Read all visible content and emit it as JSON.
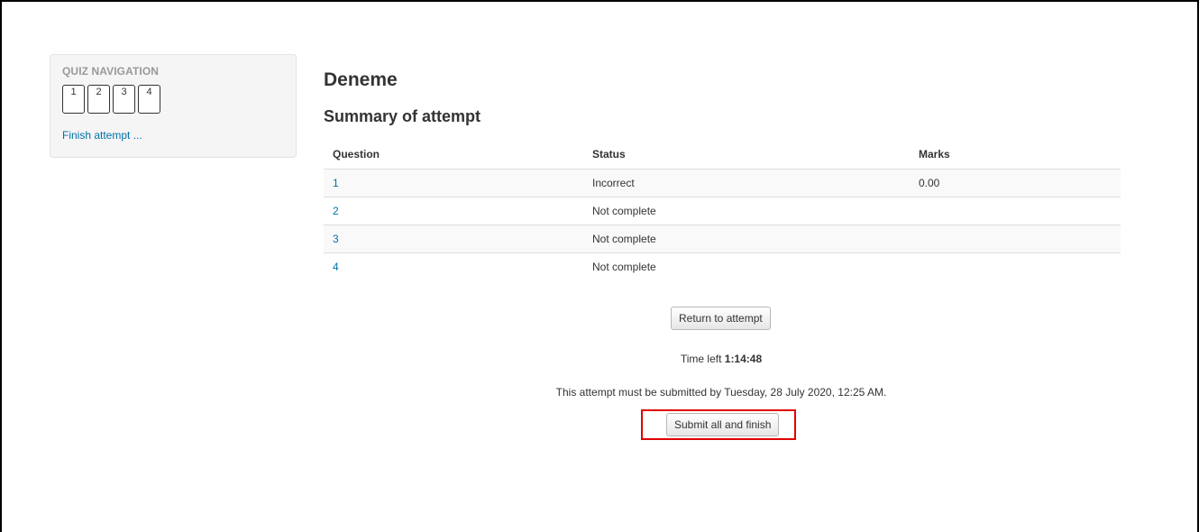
{
  "quiz_navigation": {
    "title": "QUIZ NAVIGATION",
    "buttons": [
      "1",
      "2",
      "3",
      "4"
    ],
    "finish_link": "Finish attempt ..."
  },
  "main": {
    "page_title": "Deneme",
    "summary_heading": "Summary of attempt",
    "table": {
      "headers": [
        "Question",
        "Status",
        "Marks"
      ],
      "rows": [
        {
          "question": "1",
          "status": "Incorrect",
          "marks": "0.00"
        },
        {
          "question": "2",
          "status": "Not complete",
          "marks": ""
        },
        {
          "question": "3",
          "status": "Not complete",
          "marks": ""
        },
        {
          "question": "4",
          "status": "Not complete",
          "marks": ""
        }
      ]
    },
    "return_button": "Return to attempt",
    "time_left_label": "Time left",
    "time_left_value": "1:14:48",
    "deadline_text": "This attempt must be submitted by Tuesday, 28 July 2020, 12:25 AM.",
    "submit_button": "Submit all and finish"
  },
  "colors": {
    "link": "#0070a8",
    "highlight": "#e00000"
  }
}
